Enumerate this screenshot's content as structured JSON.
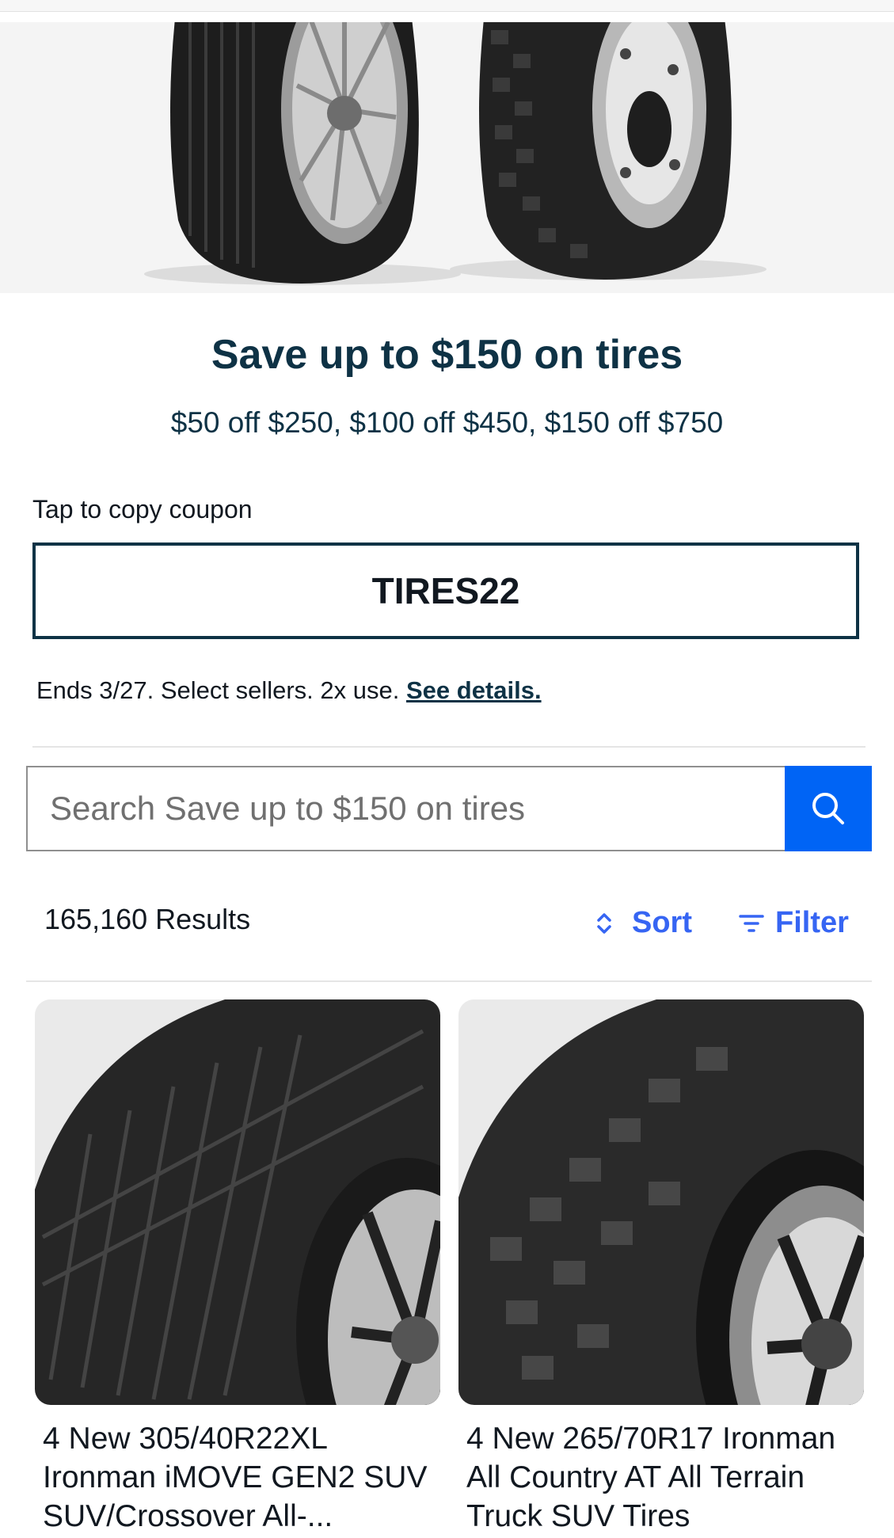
{
  "promo": {
    "title": "Save up to $150 on tires",
    "subtitle": "$50 off $250, $100 off $450, $150 off $750"
  },
  "coupon": {
    "label": "Tap to copy coupon",
    "code": "TIRES22",
    "terms": "Ends 3/27. Select sellers. 2x use.",
    "details_link": "See details."
  },
  "search": {
    "placeholder": "Search Save up to $150 on tires"
  },
  "results": {
    "count_text": "165,160 Results",
    "sort_label": "Sort",
    "filter_label": "Filter"
  },
  "listings": [
    {
      "title": "4 New 305/40R22XL Ironman iMOVE GEN2 SUV SUV/Crossover All-..."
    },
    {
      "title": "4 New 265/70R17 Ironman All Country AT All Terrain Truck SUV Tires"
    }
  ],
  "colors": {
    "accent": "#3665f3",
    "search_button": "#0064f5",
    "promo_text": "#0e3245"
  },
  "icons": {
    "search": "search-icon",
    "sort": "sort-icon",
    "filter": "filter-icon"
  }
}
